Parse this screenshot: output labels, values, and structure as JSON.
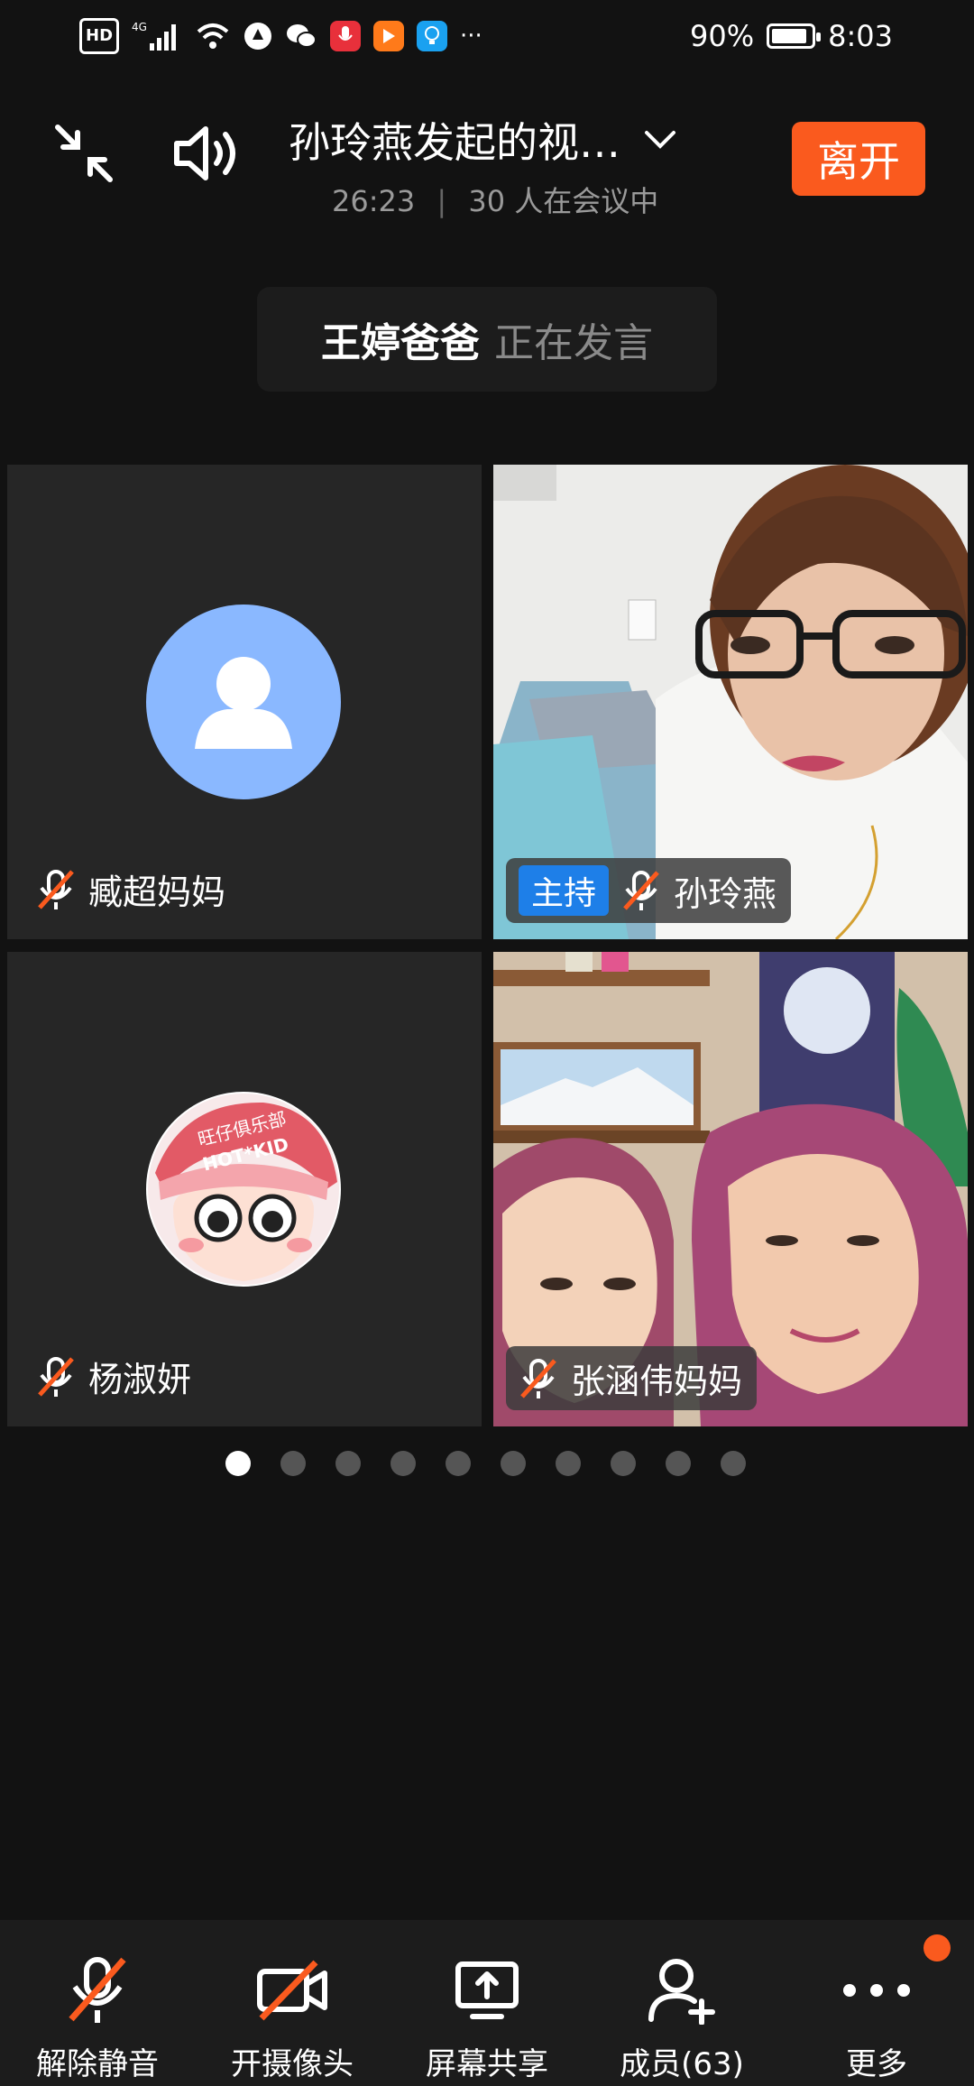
{
  "status_bar": {
    "network": "HD",
    "signal": "4G",
    "battery": "90%",
    "battery_level": 0.9,
    "time": "8:03",
    "more": "···"
  },
  "header": {
    "title": "孙玲燕发起的视…",
    "duration": "26:23",
    "separator": "|",
    "participants": "30 人在会议中",
    "leave_label": "离开"
  },
  "speaking": {
    "name": "王婷爸爸",
    "status": "正在发言"
  },
  "tiles": [
    {
      "name": "臧超妈妈"
    },
    {
      "name": "孙玲燕",
      "role": "主持"
    },
    {
      "name": "杨淑妍",
      "avatar_text": "旺仔俱乐部",
      "avatar_text2": "HOT*KID"
    },
    {
      "name": "张涵伟妈妈"
    }
  ],
  "toolbar": {
    "unmute": "解除静音",
    "camera": "开摄像头",
    "share": "屏幕共享",
    "members": "成员(63)",
    "more": "更多"
  },
  "colors": {
    "accent": "#fa5a1e",
    "host_badge": "#1e7fe8",
    "avatar_default": "#8ab8ff"
  }
}
